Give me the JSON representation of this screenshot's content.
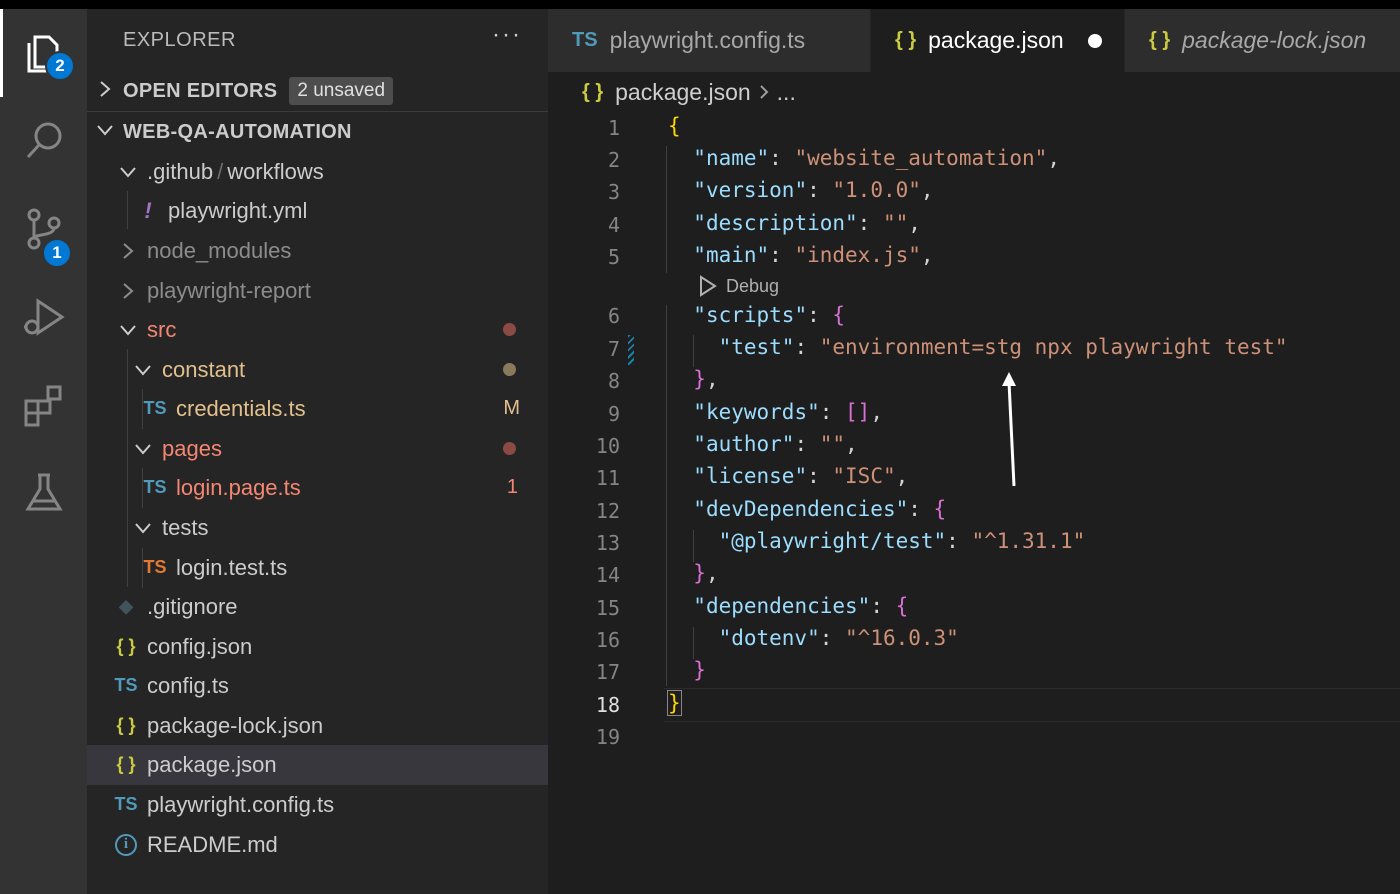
{
  "activity_bar": {
    "items": [
      {
        "icon": "files-icon",
        "badge": "2"
      },
      {
        "icon": "search-icon"
      },
      {
        "icon": "source-control-icon",
        "badge": "1"
      },
      {
        "icon": "run-debug-icon"
      },
      {
        "icon": "extensions-icon"
      },
      {
        "icon": "testing-icon"
      }
    ]
  },
  "sidebar": {
    "title": "EXPLORER",
    "more": "···",
    "open_editors": {
      "label": "OPEN EDITORS",
      "unsaved": "2 unsaved"
    },
    "project": {
      "label": "WEB-QA-AUTOMATION"
    },
    "tree": [
      {
        "name": ".github",
        "name2": "workflows",
        "icon": "",
        "color": "#cccccc"
      },
      {
        "name": "playwright.yml",
        "icon": "!",
        "color": "#cccccc"
      },
      {
        "name": "node_modules",
        "icon": "",
        "color": "#8c8c8c"
      },
      {
        "name": "playwright-report",
        "icon": "",
        "color": "#8c8c8c"
      },
      {
        "name": "src",
        "icon": "",
        "color": "#f48771"
      },
      {
        "name": "constant",
        "icon": "",
        "color": "#e2c08d"
      },
      {
        "name": "credentials.ts",
        "icon": "TS",
        "color": "#e2c08d",
        "deco": "M"
      },
      {
        "name": "pages",
        "icon": "",
        "color": "#f48771"
      },
      {
        "name": "login.page.ts",
        "icon": "TS",
        "color": "#f48771",
        "deco": "1"
      },
      {
        "name": "tests",
        "icon": "",
        "color": "#cccccc"
      },
      {
        "name": "login.test.ts",
        "icon": "TS",
        "color": "#cccccc"
      },
      {
        "name": ".gitignore",
        "icon": "◆",
        "color": "#cccccc"
      },
      {
        "name": "config.json",
        "icon": "{ }",
        "color": "#cccccc"
      },
      {
        "name": "config.ts",
        "icon": "TS",
        "color": "#cccccc"
      },
      {
        "name": "package-lock.json",
        "icon": "{ }",
        "color": "#cccccc"
      },
      {
        "name": "package.json",
        "icon": "{ }",
        "color": "#cccccc"
      },
      {
        "name": "playwright.config.ts",
        "icon": "TS",
        "color": "#cccccc"
      },
      {
        "name": "README.md",
        "icon": "i",
        "color": "#cccccc"
      }
    ]
  },
  "tabs": [
    {
      "label": "playwright.config.ts",
      "icon": "TS"
    },
    {
      "label": "package.json",
      "icon": "{ }"
    },
    {
      "label": "package-lock.json",
      "icon": "{ }"
    }
  ],
  "breadcrumb": {
    "file": "package.json",
    "more": "..."
  },
  "codelens": "Debug",
  "line_numbers": [
    "1",
    "2",
    "3",
    "4",
    "5",
    "6",
    "7",
    "8",
    "9",
    "10",
    "11",
    "12",
    "13",
    "14",
    "15",
    "16",
    "17",
    "18",
    "19"
  ],
  "code": {
    "l1": "{",
    "name_key": "\"name\"",
    "name_val": "\"website_automation\"",
    "version_key": "\"version\"",
    "version_val": "\"1.0.0\"",
    "description_key": "\"description\"",
    "description_val": "\"\"",
    "main_key": "\"main\"",
    "main_val": "\"index.js\"",
    "scripts_key": "\"scripts\"",
    "test_key": "\"test\"",
    "test_val": "\"environment=stg npx playwright test\"",
    "keywords_key": "\"keywords\"",
    "author_key": "\"author\"",
    "author_val": "\"\"",
    "license_key": "\"license\"",
    "license_val": "\"ISC\"",
    "devdeps_key": "\"devDependencies\"",
    "pw_key": "\"@playwright/test\"",
    "pw_val": "\"^1.31.1\"",
    "deps_key": "\"dependencies\"",
    "dotenv_key": "\"dotenv\"",
    "dotenv_val": "\"^16.0.3\""
  },
  "colors": {
    "accent": "#0078d4",
    "ts_blue": "#519aba",
    "ts_orange": "#e37933",
    "json_yellow": "#cbcb41"
  }
}
